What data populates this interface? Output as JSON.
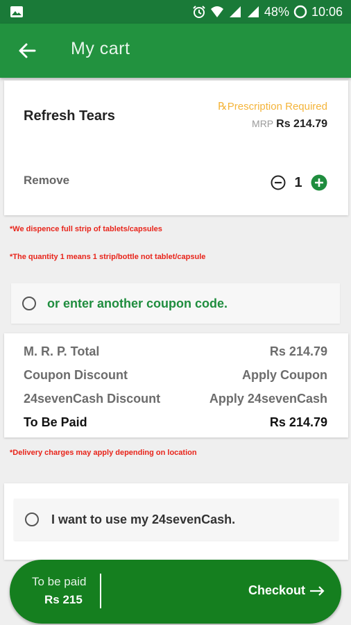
{
  "status_bar": {
    "battery": "48%",
    "time": "10:06"
  },
  "app_bar": {
    "title": "My cart"
  },
  "cart_item": {
    "name": "Refresh Tears",
    "prescription_label": "Prescription Required",
    "rx_symbol": "℞",
    "mrp_label": "MRP",
    "price": "Rs 214.79",
    "remove_label": "Remove",
    "quantity": "1"
  },
  "notes": {
    "strip_note": "*We dispence full strip of tablets/capsules",
    "quantity_note": "*The quantity 1 means 1 strip/bottle not tablet/capsule",
    "delivery_note": "*Delivery charges may apply depending on location"
  },
  "coupon": {
    "label": "or enter another coupon code."
  },
  "summary": {
    "rows": [
      {
        "label": "M. R. P. Total",
        "value": "Rs 214.79"
      },
      {
        "label": "Coupon Discount",
        "value": "Apply Coupon"
      },
      {
        "label": "24sevenCash Discount",
        "value": "Apply 24sevenCash"
      },
      {
        "label": "To Be Paid",
        "value": "Rs 214.79"
      }
    ]
  },
  "cash_option": {
    "label": "I want to use my 24sevenCash."
  },
  "checkout_bar": {
    "to_be_paid_label": "To be paid",
    "amount": "Rs 215",
    "checkout_label": "Checkout"
  },
  "colors": {
    "primary": "#22923f",
    "status_bar": "#1a7a38",
    "checkout": "#157f1f",
    "warning": "#f4b43a",
    "error": "#e8241a"
  }
}
